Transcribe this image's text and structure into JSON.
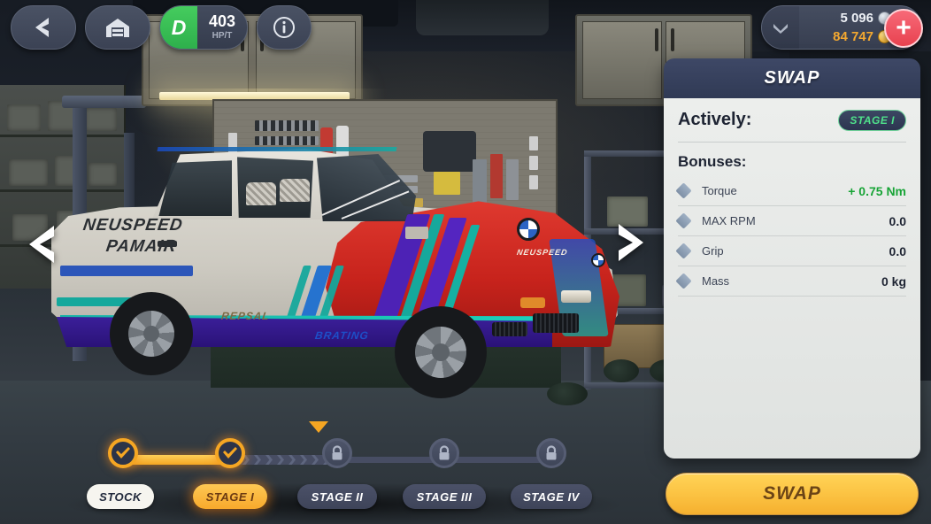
{
  "topbar": {
    "back_icon": "chevron-left-icon",
    "garage_icon": "garage-icon",
    "info_icon": "info-icon",
    "class_letter": "D",
    "power_value": "403",
    "power_unit": "HP/T",
    "class_color": "#3cc65a"
  },
  "wallet": {
    "dropdown_icon": "chevron-down-icon",
    "silver_amount": "5 096",
    "gold_amount": "84 747",
    "silver_color": "#eef1f6",
    "gold_color": "#f3a830",
    "add_label": "+"
  },
  "viewer": {
    "prev_icon": "chevron-left-icon",
    "next_icon": "chevron-right-icon",
    "car_decals": [
      "NEUSPEED",
      "PAMAIR",
      "REPSAL",
      "BRATING"
    ]
  },
  "panel": {
    "title": "SWAP",
    "actively_label": "Actively:",
    "actively_value": "STAGE I",
    "bonuses_label": "Bonuses:",
    "bonuses": [
      {
        "name": "Torque",
        "value": "+ 0.75 Nm",
        "positive": true
      },
      {
        "name": "MAX RPM",
        "value": "0.0",
        "positive": false
      },
      {
        "name": "Grip",
        "value": "0.0",
        "positive": false
      },
      {
        "name": "Mass",
        "value": "0 kg",
        "positive": false
      }
    ],
    "action_label": "SWAP",
    "action_color": "#fcc545"
  },
  "track": {
    "stages": [
      {
        "label": "STOCK",
        "state": "completed"
      },
      {
        "label": "STAGE I",
        "state": "active"
      },
      {
        "label": "STAGE II",
        "state": "locked"
      },
      {
        "label": "STAGE III",
        "state": "locked"
      },
      {
        "label": "STAGE IV",
        "state": "locked"
      }
    ],
    "check_icon": "check-icon",
    "lock_icon": "lock-icon",
    "selected_index": 1
  }
}
